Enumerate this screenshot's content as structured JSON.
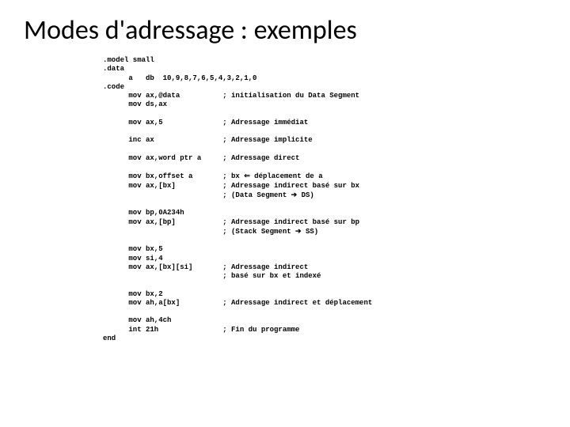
{
  "title": "Modes d'adressage : exemples",
  "code": {
    "l1": ".model small",
    "l2": ".data",
    "l3": "      a   db  10,9,8,7,6,5,4,3,2,1,0",
    "l4": ".code",
    "l5": "      mov ax,@data          ; initialisation du Data Segment",
    "l6": "      mov ds,ax",
    "l7": "",
    "l8": "      mov ax,5              ; Adressage immédiat",
    "l9": "",
    "l10": "      inc ax                ; Adressage implicite",
    "l11": "",
    "l12": "      mov ax,word ptr a     ; Adressage direct",
    "l13": "",
    "l14a": "      mov bx,offset a       ; bx ",
    "l14b": " déplacement de a",
    "l15": "      mov ax,[bx]           ; Adressage indirect basé sur bx",
    "l16a": "                            ; (Data Segment ",
    "l16b": " DS)",
    "l17": "",
    "l18": "      mov bp,0A234h",
    "l19": "      mov ax,[bp]           ; Adressage indirect basé sur bp",
    "l20a": "                            ; (Stack Segment ",
    "l20b": " SS)",
    "l21": "",
    "l22": "      mov bx,5",
    "l23": "      mov si,4",
    "l24": "      mov ax,[bx][si]       ; Adressage indirect",
    "l25": "                            ; basé sur bx et indexé",
    "l26": "",
    "l27": "      mov bx,2",
    "l28": "      mov ah,a[bx]          ; Adressage indirect et déplacement",
    "l29": "",
    "l30": "      mov ah,4ch",
    "l31": "      int 21h               ; Fin du programme",
    "l32": "end"
  },
  "arrows": {
    "left": "⇐",
    "right": "➔"
  }
}
